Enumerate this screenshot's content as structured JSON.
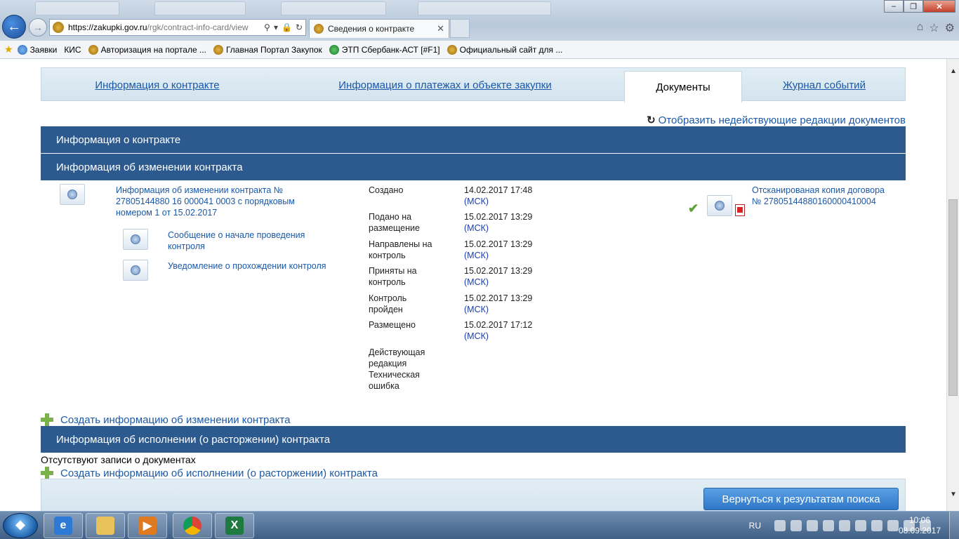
{
  "browser": {
    "url_host": "https://zakupki.gov.ru",
    "url_path": "/rgk/contract-info-card/view",
    "active_tab_title": "Сведения о контракте",
    "favorites": [
      "Заявки",
      "КИС",
      "Авторизация на портале ...",
      "Главная Портал Закупок",
      "ЭТП Сбербанк-АСТ [#F1]",
      "Официальный сайт для ..."
    ]
  },
  "page_tabs": [
    "Информация о контракте",
    "Информация о платежах и объекте закупки",
    "Документы",
    "Журнал событий"
  ],
  "show_inactive_link": "Отобразить недействующие редакции документов",
  "sections": {
    "contract_info": "Информация о контракте",
    "change_info": "Информация об изменении контракта",
    "execution_info": "Информация об исполнении (о расторжении) контракта"
  },
  "change_document": {
    "main_link": "Информация об изменении контракта № 27805144880 16 000041 0003 с порядковым номером 1 от 15.02.2017",
    "sub_links": [
      "Сообщение о начале проведения контроля",
      "Уведомление о прохождении контроля"
    ],
    "statuses": [
      {
        "label": "Создано",
        "date": "14.02.2017 17:48",
        "tz": "(МСК)"
      },
      {
        "label": "Подано на размещение",
        "date": "15.02.2017 13:29",
        "tz": "(МСК)"
      },
      {
        "label": "Направлены на контроль",
        "date": "15.02.2017 13:29",
        "tz": "(МСК)"
      },
      {
        "label": "Приняты на контроль",
        "date": "15.02.2017 13:29",
        "tz": "(МСК)"
      },
      {
        "label": "Контроль пройден",
        "date": "15.02.2017 13:29",
        "tz": "(МСК)"
      },
      {
        "label": "Размещено",
        "date": "15.02.2017 17:12",
        "tz": "(МСК)"
      },
      {
        "label": "Действующая редакция Техническая ошибка",
        "date": "",
        "tz": ""
      }
    ],
    "attachment_link": "Отсканированая копия договора № 27805144880160000410004"
  },
  "create_change_link": "Создать информацию об изменении контракта",
  "no_records_text": "Отсутствуют записи о документах",
  "create_execution_link": "Создать информацию об исполнении (о расторжении) контракта",
  "back_to_search_button": "Вернуться к результатам поиска",
  "taskbar": {
    "language": "RU",
    "time": "10:06",
    "date": "08.09.2017"
  },
  "colors": {
    "section_header": "#2c5a8e",
    "link": "#1b58a8",
    "button": "#2f78c8"
  }
}
